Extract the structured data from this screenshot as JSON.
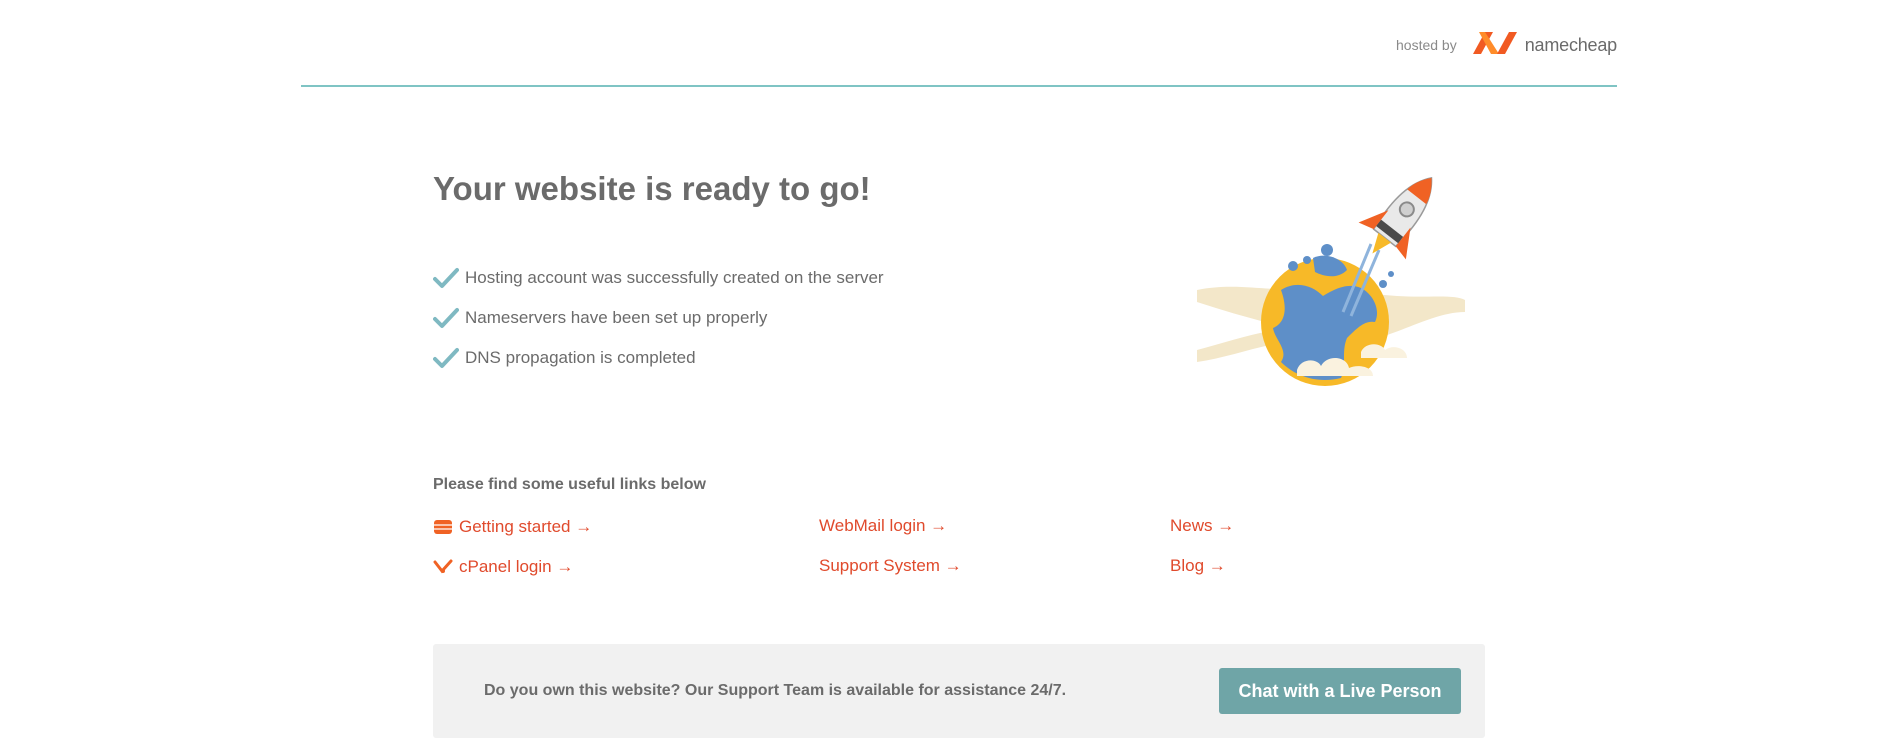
{
  "header": {
    "hosted_by": "hosted by",
    "brand_name": "namecheap",
    "brand_color": "#f06224",
    "divider_color": "#7fc4c4"
  },
  "main": {
    "title": "Your website is ready to go!",
    "checklist": [
      "Hosting account was successfully created on the server",
      "Nameservers have been set up properly",
      "DNS propagation is completed"
    ],
    "checkmark_color": "#7fb9c2",
    "illustration": "rocket-launching-from-globe"
  },
  "links": {
    "title": "Please find some useful links below",
    "getting_started": "Getting started →",
    "cpanel_login": "cPanel login →",
    "webmail_login": "WebMail login →",
    "support_system": "Support System →",
    "news": "News →",
    "blog": "Blog →",
    "link_color": "#e04a2c",
    "icons": {
      "getting_started": "server-icon",
      "cpanel_login": "cpanel-icon"
    }
  },
  "support": {
    "text": "Do you own this website? Our Support Team is available for assistance 24/7.",
    "button_label": "Chat with a Live Person",
    "button_color": "#6fa5a7"
  }
}
